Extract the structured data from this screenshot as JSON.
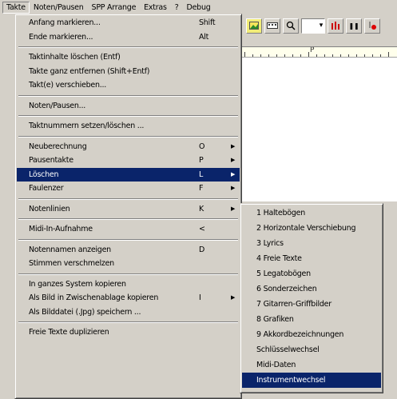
{
  "menubar": {
    "items": [
      {
        "label": "Takte",
        "open": true
      },
      {
        "label": "Noten/Pausen"
      },
      {
        "label": "SPP Arrange"
      },
      {
        "label": "Extras"
      },
      {
        "label": "?"
      },
      {
        "label": "Debug"
      }
    ]
  },
  "ruler": {
    "marker": "P"
  },
  "main_menu": {
    "items": [
      {
        "label": "Anfang markieren...",
        "accel": "Shift"
      },
      {
        "label": "Ende markieren...",
        "accel": "Alt"
      },
      {
        "sep": true
      },
      {
        "label": "Taktinhalte löschen (Entf)"
      },
      {
        "label": "Takte ganz entfernen (Shift+Entf)"
      },
      {
        "label": "Takt(e) verschieben..."
      },
      {
        "sep": true
      },
      {
        "label": "Noten/Pausen..."
      },
      {
        "sep": true
      },
      {
        "label": "Taktnummern setzen/löschen ..."
      },
      {
        "sep": true
      },
      {
        "label": "Neuberechnung",
        "accel": "O",
        "submenu": true
      },
      {
        "label": "Pausentakte",
        "accel": "P",
        "submenu": true
      },
      {
        "label": "Löschen",
        "accel": "L",
        "submenu": true,
        "highlight": true
      },
      {
        "label": "Faulenzer",
        "accel": "F",
        "submenu": true
      },
      {
        "sep": true
      },
      {
        "label": "Notenlinien",
        "accel": "K",
        "submenu": true
      },
      {
        "sep": true
      },
      {
        "label": "Midi-In-Aufnahme",
        "accel": "<"
      },
      {
        "sep": true
      },
      {
        "label": "Notennamen anzeigen",
        "accel": "D"
      },
      {
        "label": "Stimmen verschmelzen"
      },
      {
        "sep": true
      },
      {
        "label": "In ganzes System kopieren"
      },
      {
        "label": "Als Bild in Zwischenablage kopieren",
        "accel": "I",
        "submenu": true
      },
      {
        "label": "Als Bilddatei (.Jpg) speichern ..."
      },
      {
        "sep": true
      },
      {
        "label": "Freie Texte duplizieren"
      }
    ]
  },
  "sub_menu": {
    "items": [
      {
        "label": "1 Haltebögen"
      },
      {
        "label": "2 Horizontale Verschiebung"
      },
      {
        "label": "3 Lyrics"
      },
      {
        "label": "4 Freie Texte"
      },
      {
        "label": "5 Legatobögen"
      },
      {
        "label": "6 Sonderzeichen"
      },
      {
        "label": "7 Gitarren-Griffbilder"
      },
      {
        "label": "8 Grafiken"
      },
      {
        "label": "9 Akkordbezeichnungen"
      },
      {
        "label": "Schlüsselwechsel"
      },
      {
        "label": "Midi-Daten"
      },
      {
        "label": "Instrumentwechsel",
        "highlight": true
      }
    ]
  },
  "icons": {
    "submenu_arrow": "▶",
    "dropdown_arrow": "▾",
    "search": "🔍",
    "pause": "❚❚"
  }
}
